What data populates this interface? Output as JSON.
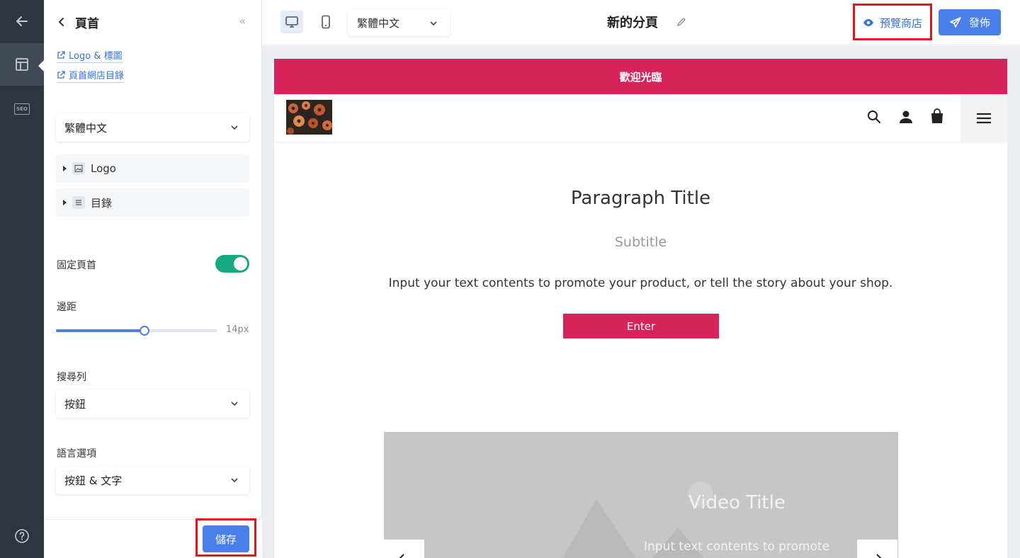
{
  "sidebar_rail": {
    "back_icon": "arrow-left-icon",
    "layout_icon": "layout-icon",
    "seo_label": "SEO",
    "help_icon": "question-circle-icon"
  },
  "panel": {
    "title": "頁首",
    "links": [
      "Logo & 標圖",
      "頁首網店目錄"
    ],
    "language_select": "繁體中文",
    "tree_items": [
      {
        "label": "Logo",
        "icon": "image-icon"
      },
      {
        "label": "目錄",
        "icon": "list-icon"
      }
    ],
    "fixed_header": {
      "label": "固定頁首",
      "enabled": true
    },
    "padding": {
      "label": "邊距",
      "value": 14,
      "value_text": "14px",
      "fraction": 0.55
    },
    "search_bar": {
      "label": "搜尋列",
      "value": "按鈕"
    },
    "language_options": {
      "label": "語言選項",
      "value": "按鈕 & 文字"
    },
    "save_label": "儲存"
  },
  "topbar": {
    "language": "繁體中文",
    "page_title": "新的分頁",
    "preview_label": "預覽商店",
    "publish_label": "發佈"
  },
  "store": {
    "announcement": "歡迎光臨",
    "paragraph_title": "Paragraph Title",
    "subtitle": "Subtitle",
    "body": "Input your text contents to promote your product, or tell the story about your shop.",
    "button": "Enter",
    "video_title": "Video Title",
    "video_text": "Input text contents to promote"
  },
  "colors": {
    "accent": "#4a7fe8",
    "brand": "#d6245a",
    "toggle_on": "#17a983",
    "highlight_box": "#e0191d"
  }
}
